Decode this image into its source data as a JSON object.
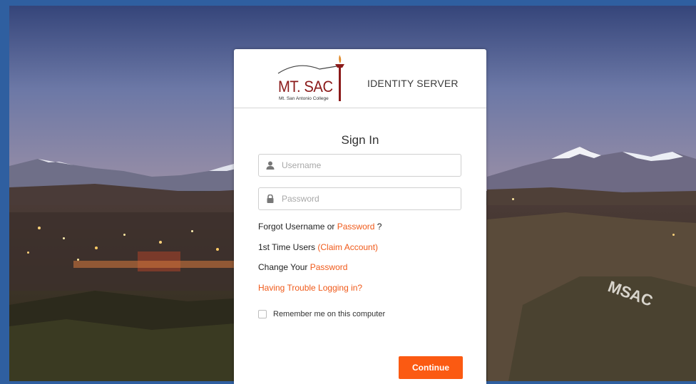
{
  "header": {
    "logo_word": "MT. SAC",
    "logo_subtitle": "Mt. San Antonio College",
    "product_title": "IDENTITY SERVER"
  },
  "form": {
    "title": "Sign In",
    "username": {
      "placeholder": "Username",
      "value": "",
      "icon": "user-icon"
    },
    "password": {
      "placeholder": "Password",
      "value": "",
      "icon": "lock-icon"
    },
    "links": {
      "forgot_prefix": "Forgot Username or",
      "forgot_link": "Password",
      "forgot_suffix": "?",
      "first_time_prefix": "1st Time Users",
      "first_time_link": "(Claim Account)",
      "change_prefix": "Change Your",
      "change_link": "Password",
      "trouble_link": "Having Trouble Logging in?"
    },
    "remember_label": "Remember me on this computer",
    "remember_checked": false,
    "continue_label": "Continue"
  },
  "colors": {
    "accent": "#fb5a12",
    "link": "#f05a1a",
    "brand": "#8b1a1a",
    "outer_border": "#2f5fa0"
  }
}
